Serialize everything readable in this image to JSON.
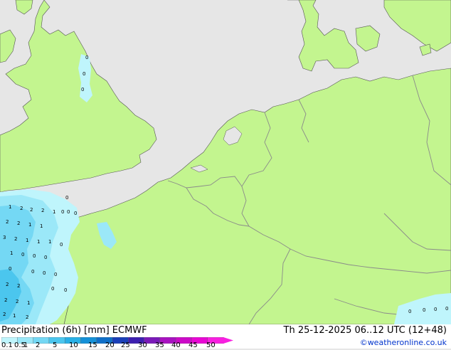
{
  "title": {
    "left": "Precipitation (6h) [mm] ECMWF",
    "right": "Th 25-12-2025 06..12 UTC (12+48)"
  },
  "credit": "©weatheronline.co.uk",
  "legend": {
    "labels": [
      "0.1",
      "0.5",
      "1",
      "2",
      "5",
      "10",
      "15",
      "20",
      "25",
      "30",
      "35",
      "40",
      "45",
      "50"
    ],
    "colors": [
      "#bff5fc",
      "#9be8f8",
      "#74d8f4",
      "#4bc6ee",
      "#29b0e6",
      "#1591d8",
      "#0f6fc8",
      "#1a3fb8",
      "#3d1fb0",
      "#7a1ab8",
      "#a812c0",
      "#cc0ac8",
      "#e808d4",
      "#f820e0"
    ]
  },
  "colors": {
    "sea": "#e6e6e6",
    "land": "#c3f58f",
    "border": "#8a8a8a",
    "coast": "#555555"
  },
  "precip_values": [
    "0",
    "0",
    "0",
    "1",
    "2",
    "2",
    "2",
    "1",
    "0",
    "0",
    "2",
    "2",
    "1",
    "1",
    "3",
    "2",
    "1",
    "1",
    "0",
    "1",
    "1",
    "0",
    "0",
    "0",
    "0",
    "0",
    "0",
    "0",
    "0",
    "0",
    "2",
    "2",
    "0",
    "0",
    "2",
    "2",
    "1",
    "2",
    "1",
    "2",
    "0",
    "0",
    "0",
    "0"
  ]
}
